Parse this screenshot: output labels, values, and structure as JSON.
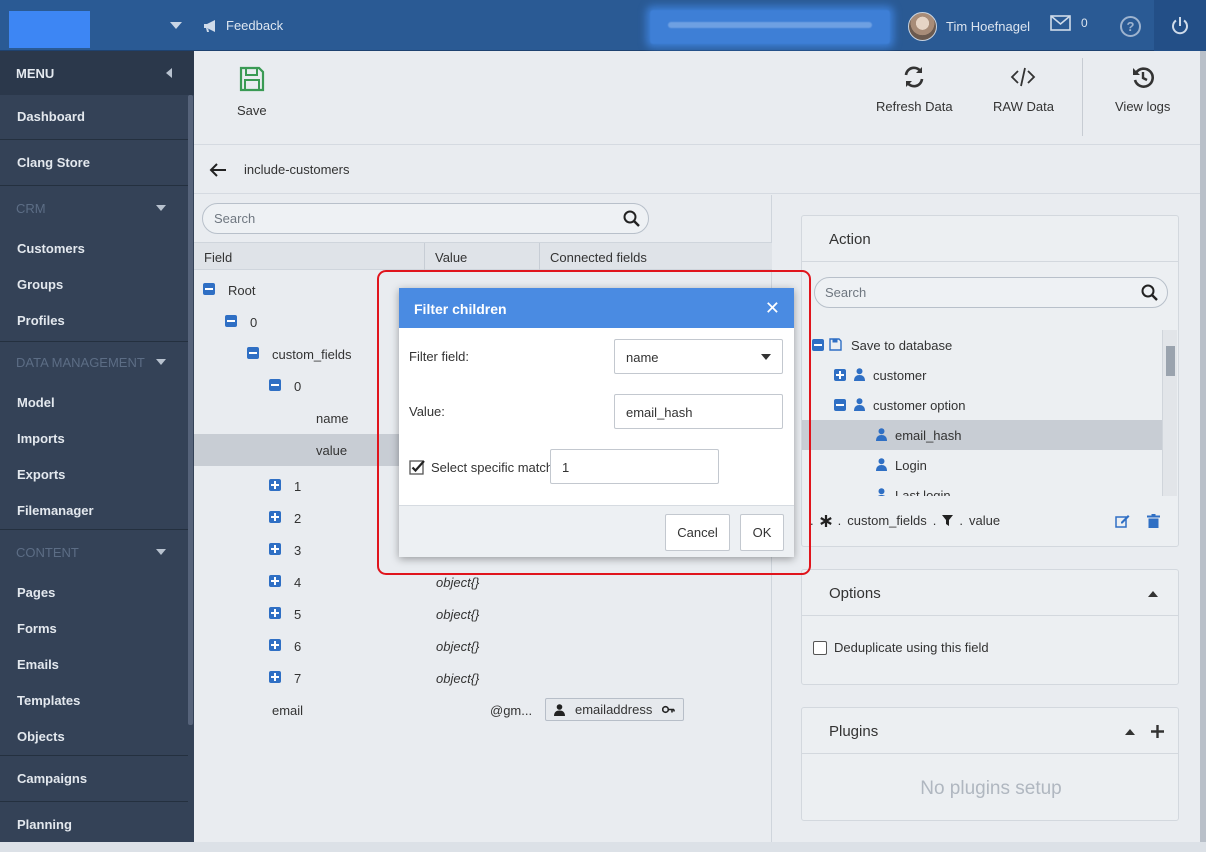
{
  "topbar": {
    "feedback_label": "Feedback",
    "user_name": "Tim Hoefnagel",
    "mail_count": "0",
    "help_label": "?"
  },
  "sidebar": {
    "menu_label": "MENU",
    "items": {
      "dashboard": "Dashboard",
      "clang_store": "Clang Store",
      "crm": "CRM",
      "customers": "Customers",
      "groups": "Groups",
      "profiles": "Profiles",
      "data_management": "DATA MANAGEMENT",
      "model": "Model",
      "imports": "Imports",
      "exports": "Exports",
      "filemanager": "Filemanager",
      "content": "CONTENT",
      "pages": "Pages",
      "forms": "Forms",
      "emails": "Emails",
      "templates": "Templates",
      "objects": "Objects",
      "campaigns": "Campaigns",
      "planning": "Planning"
    }
  },
  "toolbar": {
    "save_label": "Save",
    "refresh_label": "Refresh Data",
    "raw_label": "RAW Data",
    "logs_label": "View logs"
  },
  "breadcrumb": {
    "title": "include-customers"
  },
  "left_panel": {
    "search_placeholder": "Search",
    "columns": {
      "field": "Field",
      "value": "Value",
      "connected": "Connected fields"
    },
    "rows": {
      "root": "Root",
      "r0": "0",
      "custom_fields": "custom_fields",
      "cf0": "0",
      "name": "name",
      "value": "value",
      "n1": "1",
      "n2": "2",
      "n3": "3",
      "n4": "4",
      "n5": "5",
      "n6": "6",
      "n7": "7",
      "obj": "object{}",
      "email": "email",
      "email_value": "@gm...",
      "email_connected": "emailaddress"
    }
  },
  "action_panel": {
    "title": "Action",
    "search_placeholder": "Search",
    "tree": {
      "save_to_db": "Save to database",
      "customer": "customer",
      "customer_option": "customer option",
      "email_hash": "email_hash",
      "login": "Login",
      "last_login": "Last login"
    },
    "path": {
      "custom_fields": "custom_fields",
      "value": "value",
      "sep": "."
    }
  },
  "options_panel": {
    "title": "Options",
    "dedupe_label": "Deduplicate using this field"
  },
  "plugins_panel": {
    "title": "Plugins",
    "empty": "No plugins setup"
  },
  "modal": {
    "title": "Filter children",
    "filter_field_label": "Filter field:",
    "filter_field_value": "name",
    "value_label": "Value:",
    "value_value": "email_hash",
    "specific_label": "Select specific match:",
    "specific_value": "1",
    "cancel_label": "Cancel",
    "ok_label": "OK"
  },
  "colors": {
    "topbar": "#2a5a94",
    "sidebar": "#344257",
    "modal_header": "#4a8be2",
    "highlight": "#e0141c",
    "accent_blue": "#2f6fc4"
  }
}
